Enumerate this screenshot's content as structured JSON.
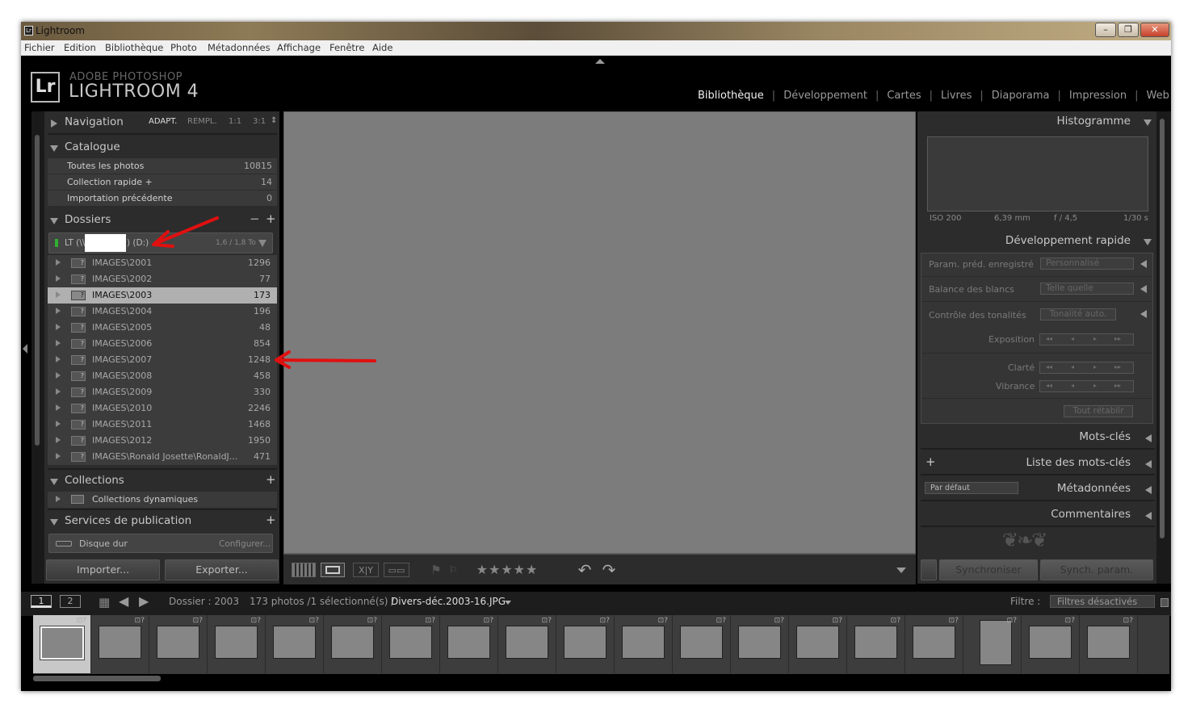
{
  "window": {
    "title": "Lightroom",
    "icon": "Lr",
    "controls": {
      "minimize": "–",
      "maximize": "❐",
      "close": "✕"
    }
  },
  "menu": [
    "Fichier",
    "Edition",
    "Bibliothèque",
    "Photo",
    "Métadonnées",
    "Affichage",
    "Fenêtre",
    "Aide"
  ],
  "brand": {
    "logo": "Lr",
    "line1": "ADOBE PHOTOSHOP",
    "line2": "LIGHTROOM 4"
  },
  "modules": [
    {
      "label": "Bibliothèque",
      "active": true
    },
    {
      "label": "Développement",
      "active": false
    },
    {
      "label": "Cartes",
      "active": false
    },
    {
      "label": "Livres",
      "active": false
    },
    {
      "label": "Diaporama",
      "active": false
    },
    {
      "label": "Impression",
      "active": false
    },
    {
      "label": "Web",
      "active": false
    }
  ],
  "left": {
    "navigation": {
      "title": "Navigation",
      "zoom": [
        "ADAPT.",
        "REMPL.",
        "1:1",
        "3:1"
      ],
      "zoom_arrows": "⇕"
    },
    "catalogue": {
      "title": "Catalogue",
      "rows": [
        {
          "label": "Toutes les photos",
          "count": "10815"
        },
        {
          "label": "Collection rapide +",
          "count": "14"
        },
        {
          "label": "Importation précédente",
          "count": "0"
        }
      ]
    },
    "dossiers": {
      "title": "Dossiers",
      "minus": "−",
      "plus": "+",
      "drive": {
        "prefix": "LT (\\\\",
        "suffix": ") (D:)",
        "usage": "1,6 / 1,8 To"
      },
      "folders": [
        {
          "name": "IMAGES\\2001",
          "count": "1296",
          "selected": false
        },
        {
          "name": "IMAGES\\2002",
          "count": "77",
          "selected": false
        },
        {
          "name": "IMAGES\\2003",
          "count": "173",
          "selected": true
        },
        {
          "name": "IMAGES\\2004",
          "count": "196",
          "selected": false
        },
        {
          "name": "IMAGES\\2005",
          "count": "48",
          "selected": false
        },
        {
          "name": "IMAGES\\2006",
          "count": "854",
          "selected": false
        },
        {
          "name": "IMAGES\\2007",
          "count": "1248",
          "selected": false
        },
        {
          "name": "IMAGES\\2008",
          "count": "458",
          "selected": false
        },
        {
          "name": "IMAGES\\2009",
          "count": "330",
          "selected": false
        },
        {
          "name": "IMAGES\\2010",
          "count": "2246",
          "selected": false
        },
        {
          "name": "IMAGES\\2011",
          "count": "1468",
          "selected": false
        },
        {
          "name": "IMAGES\\2012",
          "count": "1950",
          "selected": false
        },
        {
          "name": "IMAGES\\Ronald Josette\\RonaldJ...",
          "count": "471",
          "selected": false
        }
      ],
      "missing_mark": "?"
    },
    "collections": {
      "title": "Collections",
      "plus": "+",
      "item": "Collections dynamiques"
    },
    "publish": {
      "title": "Services de publication",
      "plus": "+",
      "item": "Disque dur",
      "configure": "Configurer..."
    },
    "import_button": "Importer...",
    "export_button": "Exporter..."
  },
  "right": {
    "histogram": {
      "title": "Histogramme",
      "iso": "ISO 200",
      "focal": "6,39 mm",
      "aperture": "f / 4,5",
      "shutter": "1/30 s"
    },
    "quick_develop": {
      "title": "Développement rapide",
      "preset_label": "Param. préd. enregistré",
      "preset_value": "Personnalisé",
      "wb_label": "Balance des blancs",
      "wb_value": "Telle quelle",
      "tone_label": "Contrôle des tonalités",
      "tone_button": "Tonalité auto.",
      "exposure_label": "Exposition",
      "clarity_label": "Clarté",
      "vibrance_label": "Vibrance",
      "reset_button": "Tout rétablir",
      "step_glyphs": [
        "◂◂",
        "◂",
        "▸",
        "▸▸"
      ]
    },
    "keywords": {
      "title": "Mots-clés"
    },
    "keyword_list": {
      "title": "Liste des mots-clés",
      "plus": "+"
    },
    "metadata": {
      "title": "Métadonnées",
      "preset": "Par défaut"
    },
    "comments": {
      "title": "Commentaires"
    },
    "ornament": "❦❧❦",
    "sync_button": "Synchroniser",
    "sync_settings_button": "Synch. param."
  },
  "toolbar": {
    "stars": "★★★★★",
    "rotate_left": "↶",
    "rotate_right": "↷",
    "flag": "⚑"
  },
  "statusbar": {
    "screen1": "1",
    "screen2": "2",
    "folder": "Dossier : 2003",
    "count": "173 photos /1 sélectionné(s) /",
    "filename": "Divers-déc.2003-16.JPG",
    "filter_label": "Filtre :",
    "filter_value": "Filtres désactivés"
  },
  "filmstrip": {
    "thumbs": 19,
    "selected_index": 0,
    "portrait_index": 16,
    "badge": "⊡?"
  }
}
